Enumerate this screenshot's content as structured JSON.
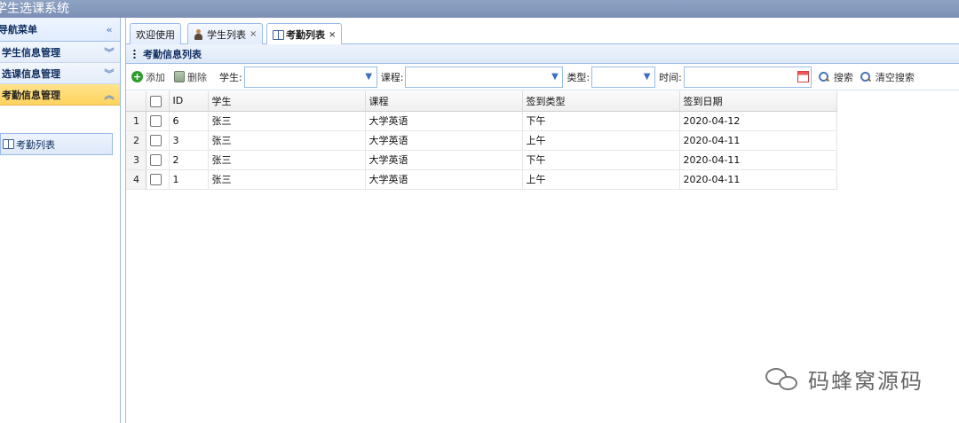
{
  "app": {
    "title": "学生选课系统"
  },
  "sidebar": {
    "header": "导航菜单",
    "sections": [
      {
        "label": "学生信息管理",
        "chevron": "double-chevron-down-icon"
      },
      {
        "label": "选课信息管理",
        "chevron": "double-chevron-down-icon"
      },
      {
        "label": "考勤信息管理",
        "chevron": "double-chevron-up-icon",
        "active": true
      }
    ],
    "items": [
      {
        "label": "考勤列表"
      }
    ]
  },
  "tabs": [
    {
      "label": "欢迎使用"
    },
    {
      "label": "学生列表",
      "close": "×"
    },
    {
      "label": "考勤列表",
      "close": "×",
      "selected": true
    }
  ],
  "panel": {
    "title": "考勤信息列表"
  },
  "toolbar": {
    "add_label": "添加",
    "delete_label": "删除",
    "student_label": "学生:",
    "course_label": "课程:",
    "type_label": "类型:",
    "time_label": "时间:",
    "search_label": "搜索",
    "clear_label": "清空搜索"
  },
  "grid": {
    "columns": [
      "ID",
      "学生",
      "课程",
      "签到类型",
      "签到日期"
    ],
    "rows": [
      {
        "rownum": "1",
        "id": "6",
        "student": "张三",
        "course": "大学英语",
        "type": "下午",
        "date": "2020-04-12"
      },
      {
        "rownum": "2",
        "id": "3",
        "student": "张三",
        "course": "大学英语",
        "type": "上午",
        "date": "2020-04-11"
      },
      {
        "rownum": "3",
        "id": "2",
        "student": "张三",
        "course": "大学英语",
        "type": "下午",
        "date": "2020-04-11"
      },
      {
        "rownum": "4",
        "id": "1",
        "student": "张三",
        "course": "大学英语",
        "type": "上午",
        "date": "2020-04-11"
      }
    ]
  },
  "watermark": {
    "text": "码蜂窝源码"
  },
  "colors": {
    "accent": "#99bbe8",
    "active_section": "#ffd35e",
    "topbar": "#7b90b4"
  }
}
